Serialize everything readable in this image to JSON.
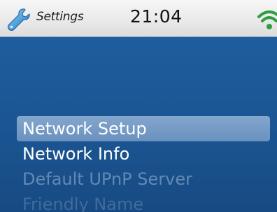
{
  "status_bar": {
    "title": "Settings",
    "time": "21:04",
    "title_icon": "wrench-icon",
    "signal_icon": "wifi-icon",
    "accent_color": "#2e9e3f"
  },
  "menu": {
    "items": [
      {
        "label": "Network Setup",
        "state": "selected"
      },
      {
        "label": "Network Info",
        "state": "enabled"
      },
      {
        "label": "Default UPnP Server",
        "state": "disabled"
      },
      {
        "label": "Friendly Name",
        "state": "disabled"
      }
    ]
  },
  "colors": {
    "background": "#1d5a99",
    "selection": "#8fb0d6",
    "text": "#ffffff",
    "disabled_text": "#8fa9c9"
  }
}
